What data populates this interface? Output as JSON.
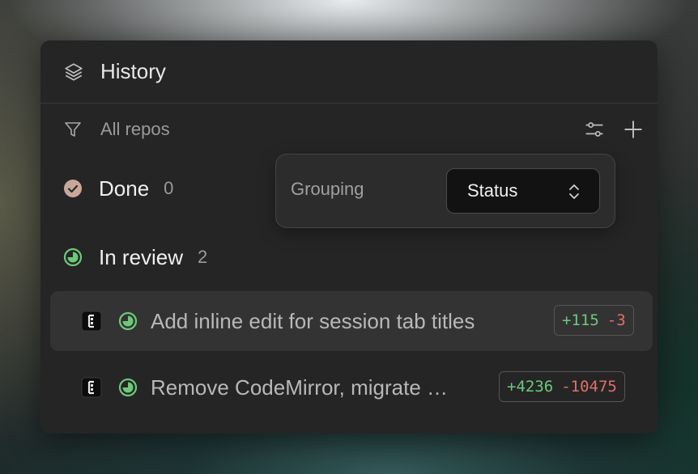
{
  "header": {
    "title": "History",
    "icon": "layers-icon"
  },
  "filter": {
    "label": "All repos",
    "icon": "filter-icon"
  },
  "toolbar": {
    "settings_icon": "sliders-icon",
    "add_icon": "plus-icon"
  },
  "groups": [
    {
      "name": "Done",
      "count": "0",
      "icon": "check-circle-icon",
      "color": "#c9a89a"
    },
    {
      "name": "In review",
      "count": "2",
      "icon": "progress-circle-icon",
      "color": "#6cc97a"
    }
  ],
  "popover": {
    "label": "Grouping",
    "value": "Status"
  },
  "items": [
    {
      "title": "Add inline edit for session tab titles",
      "added": "+115",
      "removed": "-3"
    },
    {
      "title": "Remove CodeMirror, migrate …",
      "added": "+4236",
      "removed": "-10475"
    }
  ],
  "colors": {
    "added": "#6cc97a",
    "removed": "#e07068",
    "in_review": "#6cc97a",
    "done": "#c9a89a"
  }
}
